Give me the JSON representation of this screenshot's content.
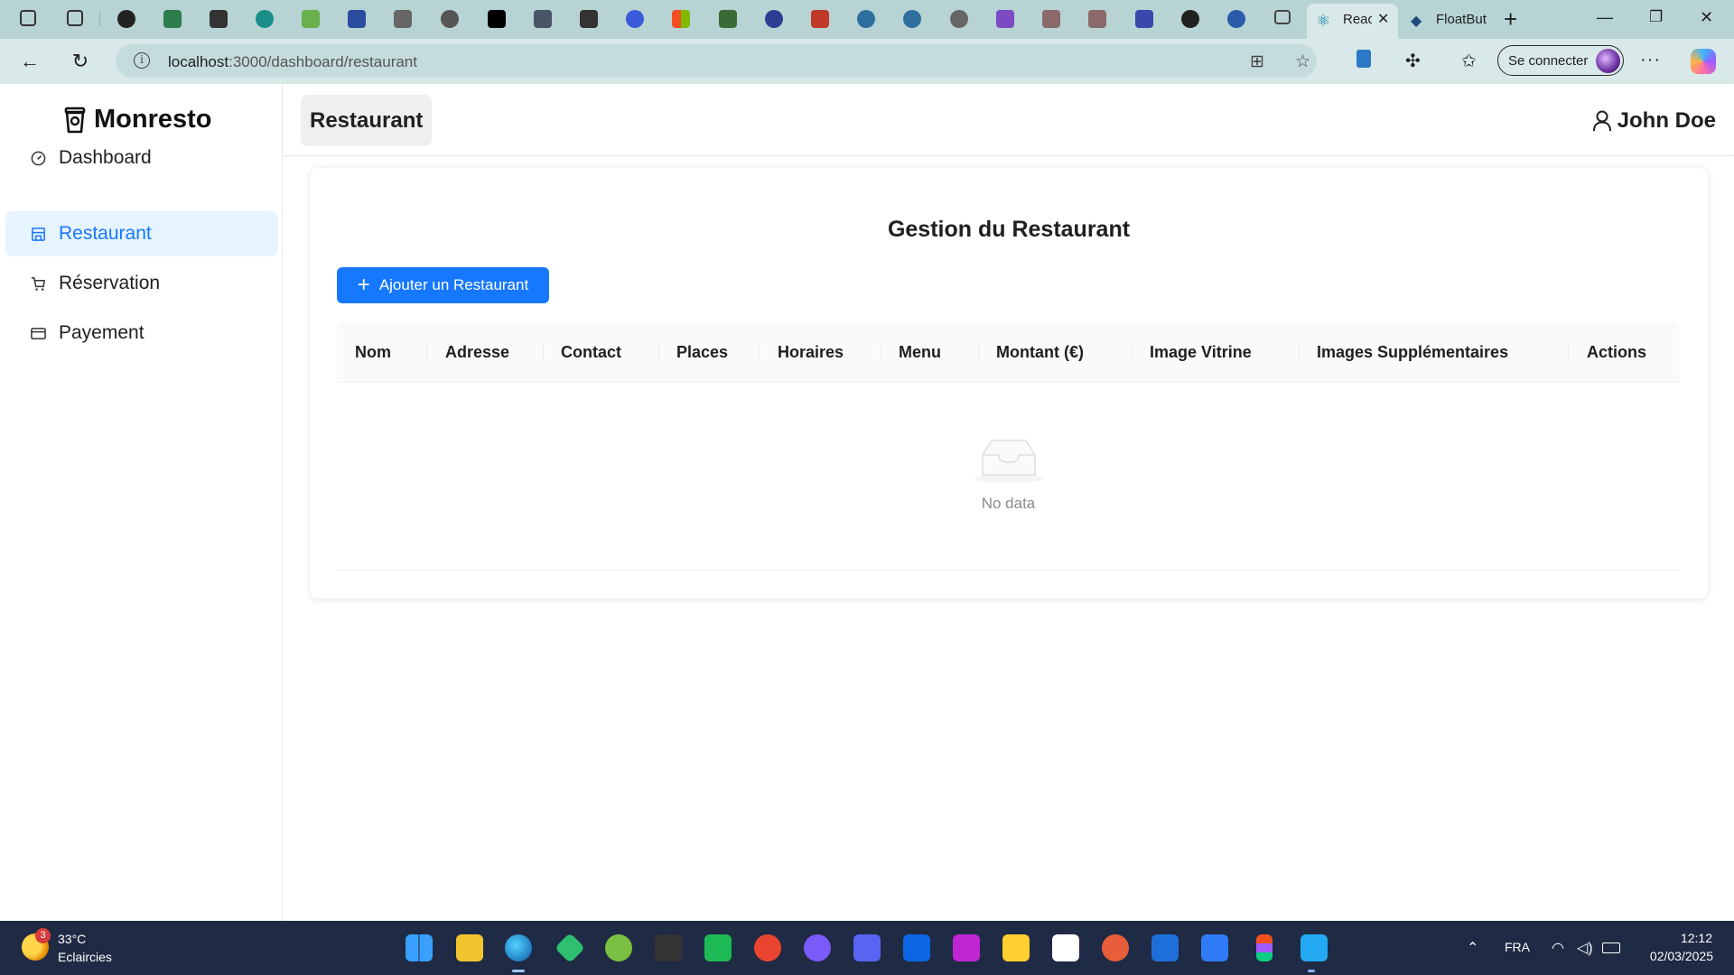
{
  "browser": {
    "tabs": [
      {
        "title": "Reac",
        "active": true,
        "icon": "react-icon"
      },
      {
        "title": "FloatBut",
        "active": false,
        "icon": "diamond-icon"
      }
    ],
    "url_host": "localhost",
    "url_path": ":3000/dashboard/restaurant",
    "signin_label": "Se connecter"
  },
  "sidebar": {
    "brand": "Monresto",
    "items": [
      {
        "label": "Dashboard",
        "icon": "dashboard-icon",
        "active": false
      },
      {
        "label": "Restaurant",
        "icon": "shop-icon",
        "active": true
      },
      {
        "label": "Réservation",
        "icon": "cart-icon",
        "active": false
      },
      {
        "label": "Payement",
        "icon": "credit-card-icon",
        "active": false
      }
    ]
  },
  "header": {
    "title": "Restaurant",
    "user_name": "John Doe"
  },
  "main": {
    "title": "Gestion du Restaurant",
    "add_button_label": "Ajouter un Restaurant",
    "columns": [
      "Nom",
      "Adresse",
      "Contact",
      "Places",
      "Horaires",
      "Menu",
      "Montant (€)",
      "Image Vitrine",
      "Images Supplémentaires",
      "Actions"
    ],
    "rows": [],
    "empty_text": "No data"
  },
  "taskbar": {
    "weather_badge": "3",
    "weather_temp": "33°C",
    "weather_condition": "Eclaircies",
    "language": "FRA",
    "time": "12:12",
    "date": "02/03/2025"
  },
  "colors": {
    "primary": "#1677ff",
    "active_menu_bg": "#e6f4ff",
    "browser_frame": "#b7d3d4",
    "taskbar": "#1f2a44"
  }
}
